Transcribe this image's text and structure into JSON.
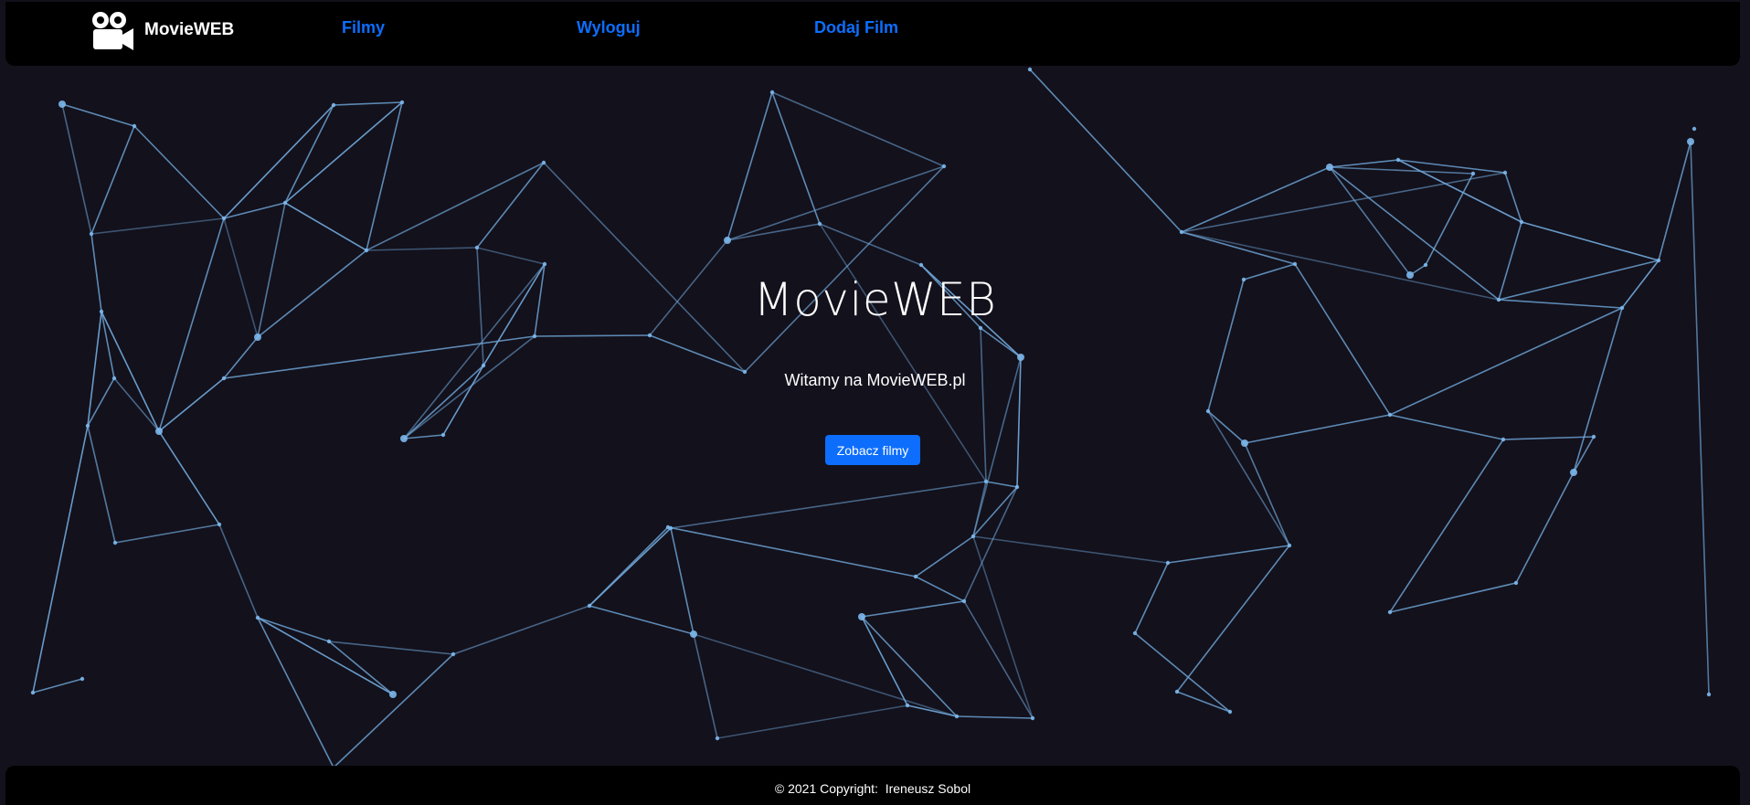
{
  "navbar": {
    "brand": "MovieWEB",
    "brand_icon": "movie-camera-icon",
    "links": [
      "Filmy",
      "Wyloguj",
      "Dodaj Film"
    ]
  },
  "hero": {
    "title": "MovieWEB",
    "subtitle": "Witamy na MovieWEB.pl",
    "button": "Zobacz filmy"
  },
  "footer": {
    "copyright": "© 2021 Copyright:",
    "author": "Ireneusz Sobol"
  },
  "colors": {
    "background": "#13111c",
    "bar": "#000000",
    "accent": "#0d6efd",
    "network_line": "#6fa6d8"
  }
}
